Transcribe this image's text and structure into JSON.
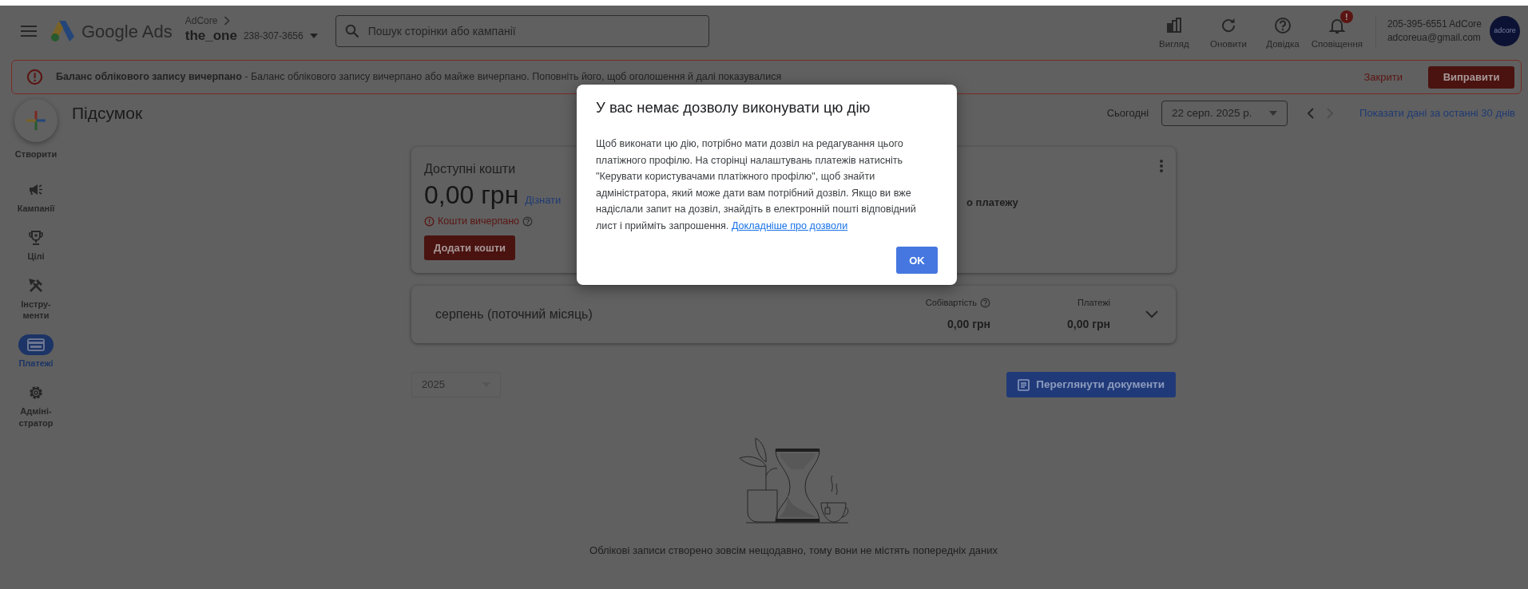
{
  "header": {
    "brand": "Google Ads",
    "account_parent": "AdCore",
    "account_name": "the_one",
    "account_id": "238-307-3656",
    "search": {
      "placeholder": "Пошук сторінки або кампанії"
    },
    "tools": [
      {
        "kind": "appearance",
        "label": "Вигляд"
      },
      {
        "kind": "refresh",
        "label": "Оновити"
      },
      {
        "kind": "help",
        "label": "Довідка"
      },
      {
        "kind": "notifications",
        "label": "Сповіщення",
        "badge": "!"
      }
    ],
    "user": {
      "line_1": "205-395-6551 AdCore",
      "email": "adcoreua@gmail.com",
      "avatar_text": "adcore"
    }
  },
  "alert": {
    "message": "**Баланс облікового запису вичерпано** - Баланс облікового запису вичерпано або майже вичерпано. Поповніть його, щоб оголошення й далі показувалися",
    "dismiss": "Закрити",
    "fix": "Виправити"
  },
  "sidebar": {
    "create": "Створити",
    "items": [
      {
        "kind": "campaigns",
        "label": "Кампанії",
        "selected": false
      },
      {
        "kind": "goals",
        "label": "Цілі",
        "selected": false
      },
      {
        "kind": "tools",
        "label": "Інстру-\nменти",
        "selected": false
      },
      {
        "kind": "billing",
        "label": "Платежі",
        "selected": true
      },
      {
        "kind": "admin",
        "label": "Адміні-\nстратор",
        "selected": false
      }
    ]
  },
  "page": {
    "title": "Підсумок",
    "today_label": "Сьогодні",
    "date": "22 серп. 2025 р.",
    "last_30": "Показати дані за останні 30 днів"
  },
  "funds_card": {
    "title": "Доступні кошти",
    "amount": "0,00 грн",
    "learn_link": "Дізнати",
    "status": "Кошти вичерпано",
    "add_button": "Додати кошти",
    "right_text": "о платежу"
  },
  "month_card": {
    "title": "серпень (поточний місяць)",
    "expanded": false,
    "columns": [
      {
        "label": "Собівартість",
        "help": true,
        "value": "0,00 грн"
      },
      {
        "label": "Платежі",
        "help": false,
        "value": "0,00 грн"
      }
    ]
  },
  "year_select": {
    "value": "2025",
    "disabled": true
  },
  "documents_button": "Переглянути документи",
  "empty_state": "Облікові записи створено зовсім нещодавно, тому вони не містять попередніх даних",
  "dialog": {
    "title": "У вас немає дозволу виконувати цю дію",
    "body": "Щоб виконати цю дію, потрібно мати дозвіл на редагування цього платіжного профілю. На сторінці налаштувань платежів натисніть \"Керувати користувачами платіжного профілю\", щоб знайти адміністратора, який може дати вам потрібний дозвіл. Якщо ви вже надіслали запит на дозвіл, знайдіть в електронній пошті відповідний лист і прийміть запрошення. ",
    "link": "Докладніше про дозволи",
    "ok": "OK"
  }
}
